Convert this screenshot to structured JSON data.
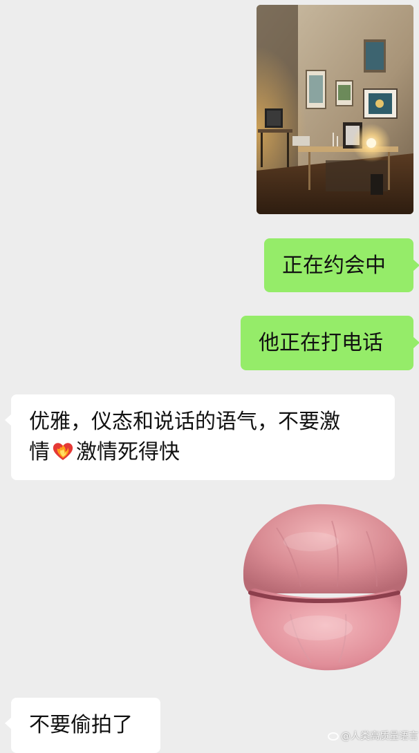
{
  "messages": [
    {
      "id": "photo",
      "direction": "outgoing",
      "type": "image",
      "image_subject": "room-photo"
    },
    {
      "id": "m1",
      "direction": "outgoing",
      "type": "text",
      "text": "正在约会中"
    },
    {
      "id": "m2",
      "direction": "outgoing",
      "type": "text",
      "text": "他正在打电话"
    },
    {
      "id": "m3",
      "direction": "incoming",
      "type": "text",
      "line1": "优雅，仪态和说话的语气，不要激",
      "line2_before": "情",
      "emoji": "heart-on-fire-icon",
      "line2_after": "激情死得快"
    },
    {
      "id": "sticker",
      "direction": "outgoing",
      "type": "sticker",
      "sticker_subject": "lips-sticker"
    },
    {
      "id": "m4",
      "direction": "incoming",
      "type": "text",
      "text": "不要偷拍了"
    }
  ],
  "watermark": {
    "text": "@人类高质量语言"
  },
  "colors": {
    "background": "#ededed",
    "outgoing_bubble": "#95ec69",
    "incoming_bubble": "#ffffff",
    "text": "#111111"
  }
}
